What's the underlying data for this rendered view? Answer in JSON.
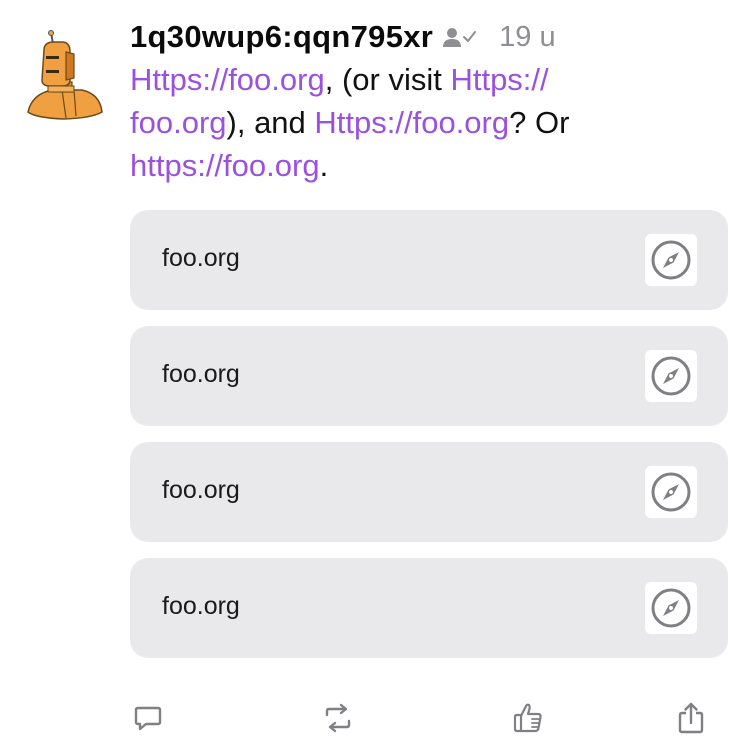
{
  "post": {
    "author": "1q30wup6:qqn795xr",
    "timestamp": "19 u",
    "text": {
      "link1": "Https://foo.org",
      "seg1": ", (or visit ",
      "link2a": "Https://",
      "link2b": "foo.org",
      "seg2": "), and ",
      "link3": "Https://foo.org",
      "seg3": "? Or",
      "link4": "https://foo.org",
      "seg4": "."
    },
    "link_cards": [
      {
        "label": "foo.org",
        "icon": "compass-icon"
      },
      {
        "label": "foo.org",
        "icon": "compass-icon"
      },
      {
        "label": "foo.org",
        "icon": "compass-icon"
      },
      {
        "label": "foo.org",
        "icon": "compass-icon"
      }
    ]
  },
  "actions": {
    "reply_icon": "reply-icon",
    "boost_icon": "boost-icon",
    "like_icon": "like-icon",
    "share_icon": "share-icon"
  },
  "colors": {
    "link": "#9b51e0",
    "muted": "#8e8e93",
    "card_bg": "#e9e9eb",
    "icon": "#7f7f84",
    "avatar": "#f0a040"
  }
}
